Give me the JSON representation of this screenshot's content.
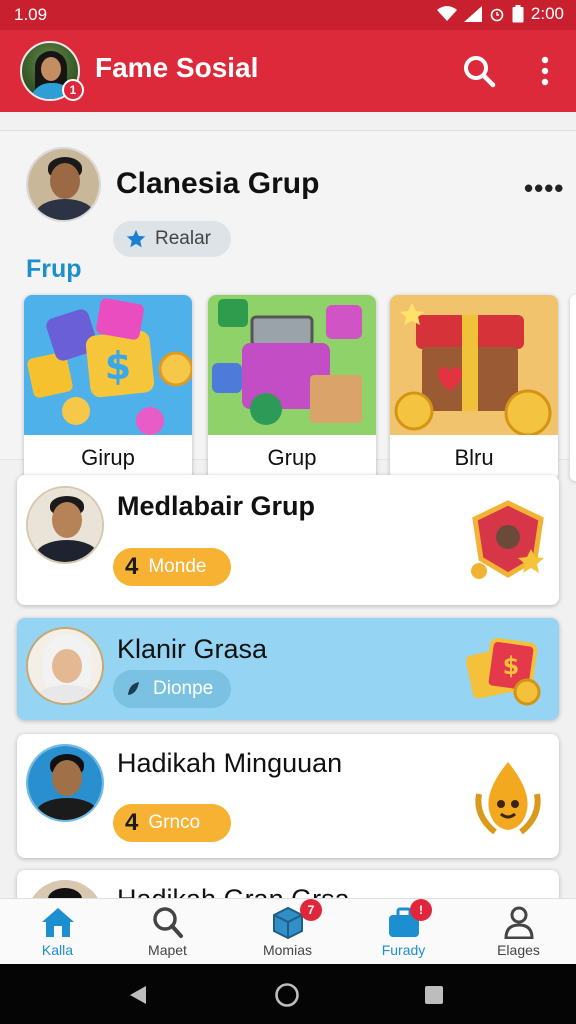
{
  "status_bar": {
    "time": "1.09",
    "clock": "2:00"
  },
  "app_bar": {
    "title": "Fame Sosial",
    "notification_count": "1"
  },
  "group_header": {
    "name": "Clanesia Grup",
    "badge_label": "Realar",
    "more_label": "••••",
    "section_label": "Frup"
  },
  "tiles": [
    {
      "label": "Girup"
    },
    {
      "label": "Grup"
    },
    {
      "label": "Blru"
    }
  ],
  "list_items": [
    {
      "title": "Medlabair Grup",
      "pill_number": "4",
      "pill_label": "Monde"
    },
    {
      "title": "Klanir Grasa",
      "pill_number": "",
      "pill_label": "Dionpe"
    },
    {
      "title": "Hadikah Minguuan",
      "pill_number": "4",
      "pill_label": "Grnco"
    },
    {
      "title": "Hadikah Gran Grsa"
    }
  ],
  "bottom_nav": {
    "items": [
      {
        "label": "Kalla"
      },
      {
        "label": "Mapet"
      },
      {
        "label": "Momias",
        "badge": "7"
      },
      {
        "label": "Furady",
        "badge": "!"
      },
      {
        "label": "Elages"
      }
    ]
  },
  "colors": {
    "primary": "#dc2a3b",
    "accent_blue": "#1d8fce",
    "highlight": "#95d4f2",
    "pill_orange": "#f7b234"
  }
}
